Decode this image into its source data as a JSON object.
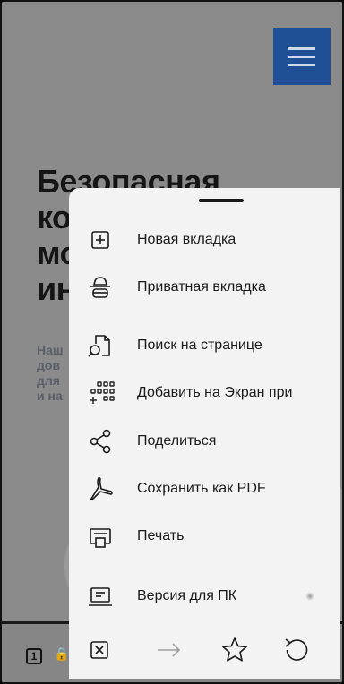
{
  "background_page": {
    "heading_lines": [
      "Безопасная",
      "ко",
      "мо",
      "ин"
    ],
    "text_lines": [
      "Наш",
      "дов",
      "для",
      "и на"
    ],
    "tab_count": "1"
  },
  "menu": {
    "items": [
      {
        "label": "Новая вкладка",
        "icon": "plus-square-icon"
      },
      {
        "label": "Приватная вкладка",
        "icon": "incognito-icon"
      },
      {
        "label": "Поиск на странице",
        "icon": "find-in-page-icon"
      },
      {
        "label": "Добавить на Экран при",
        "icon": "add-to-homescreen-icon"
      },
      {
        "label": "Поделиться",
        "icon": "share-icon"
      },
      {
        "label": "Сохранить как PDF",
        "icon": "pdf-icon"
      },
      {
        "label": "Печать",
        "icon": "print-icon"
      },
      {
        "label": "Версия для ПК",
        "icon": "desktop-icon"
      }
    ],
    "actions": [
      {
        "name": "close-tab-icon"
      },
      {
        "name": "forward-arrow-icon",
        "disabled": true
      },
      {
        "name": "bookmark-star-icon"
      },
      {
        "name": "reload-icon"
      }
    ]
  },
  "colors": {
    "menu_background": "#f3f3f3",
    "overlay_dim": "#8b8b8b",
    "hamburger_blue": "#1f4f94"
  }
}
